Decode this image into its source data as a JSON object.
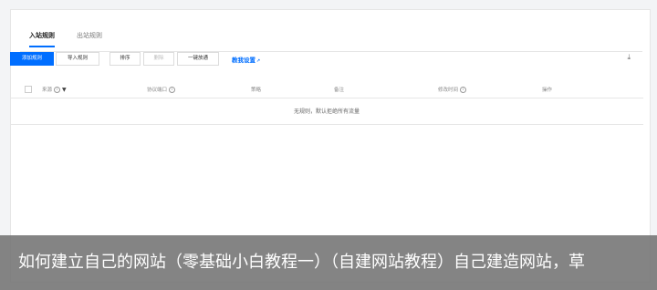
{
  "tabs": [
    {
      "label": "入站规则"
    },
    {
      "label": "出站规则"
    }
  ],
  "toolbar": {
    "add_label": "添加规则",
    "import_label": "导入规则",
    "sort_label": "排序",
    "delete_label": "删除",
    "one_click_label": "一键放通",
    "tutorial_label": "教我设置",
    "download_icon": "download-icon"
  },
  "table": {
    "columns": [
      "来源",
      "协议端口",
      "策略",
      "备注",
      "修改时间",
      "操作"
    ],
    "empty_text": "无规则，默认拒绝所有流量"
  },
  "caption": {
    "text": "如何建立自己的网站（零基础小白教程一）（自建网站教程）自己建造网站，草"
  },
  "colors": {
    "accent": "#006eff",
    "caption_bg": "#6e6e6e"
  }
}
